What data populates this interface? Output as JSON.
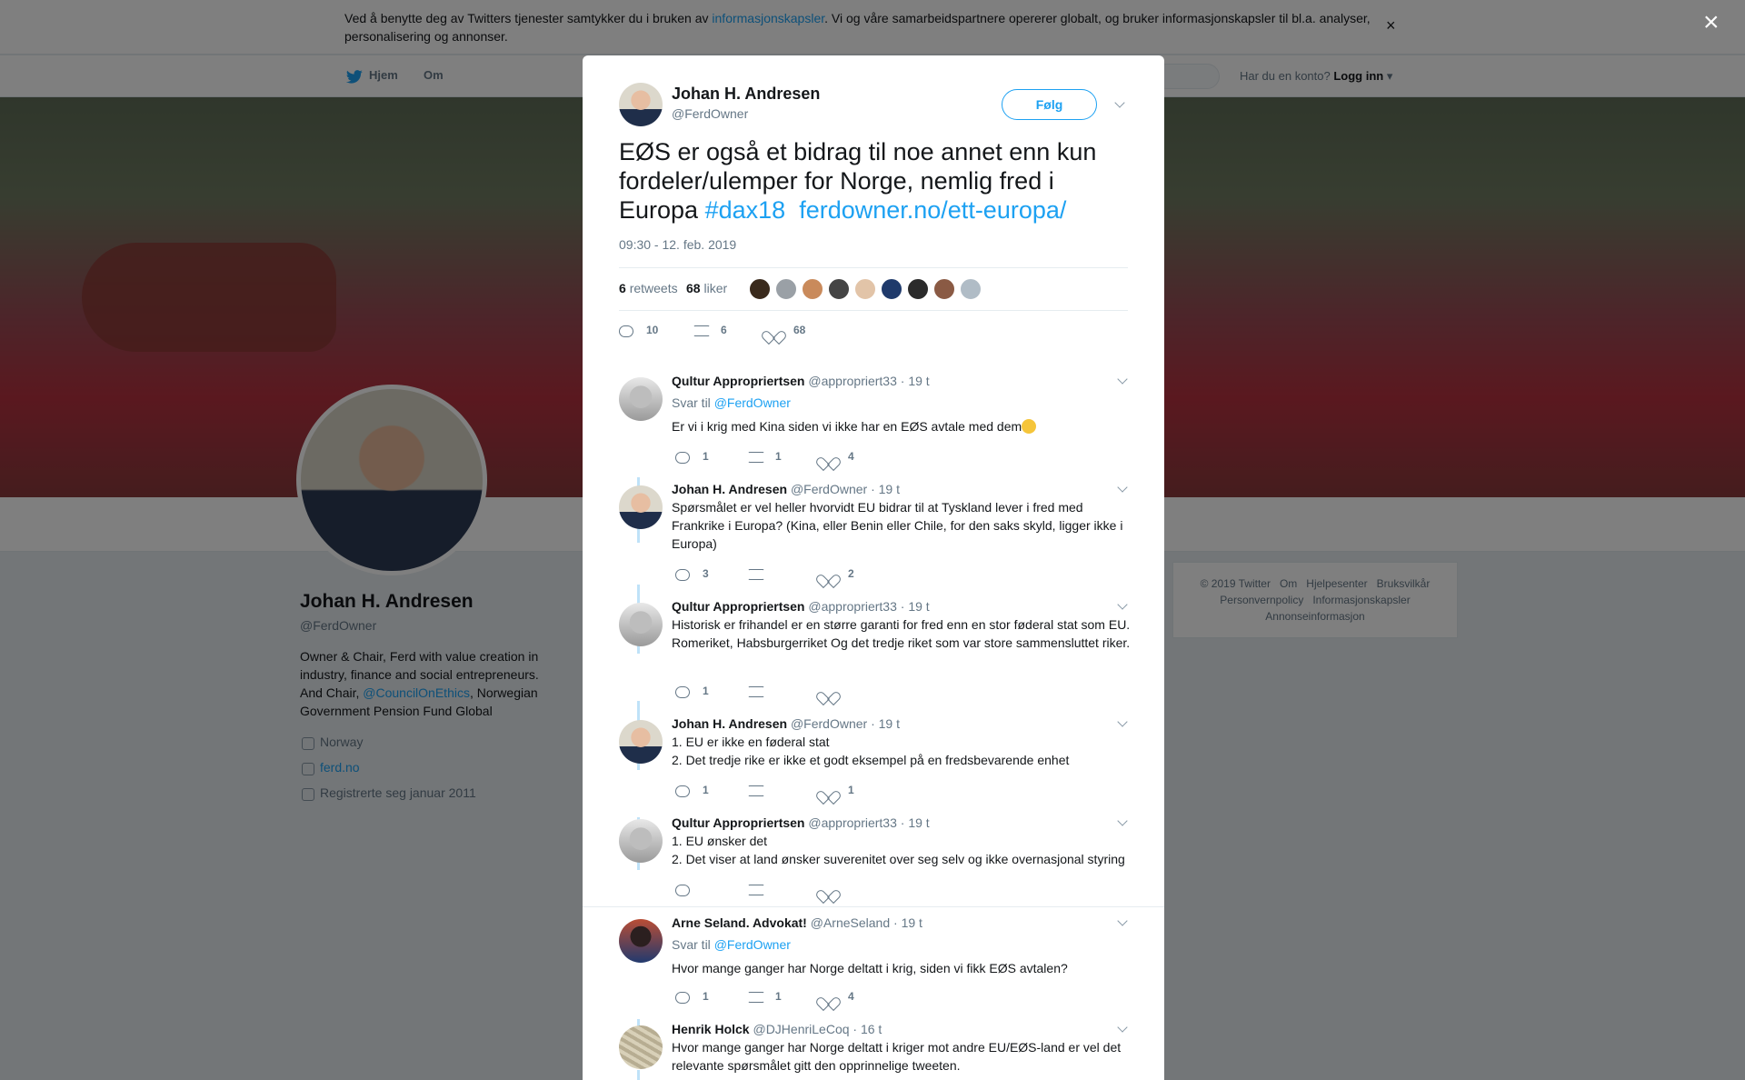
{
  "cookie_banner": {
    "text_before": "Ved å benytte deg av Twitters tjenester samtykker du i bruken av ",
    "link": "informasjonskapsler",
    "text_after": ". Vi og våre samarbeidspartnere opererer globalt, og bruker informasjonskapsler til bl.a. analyser, personalisering og annonser."
  },
  "nav": {
    "home_label": "Hjem",
    "about_label": "Om",
    "account_prompt": "Har du en konto?",
    "login_label": "Logg inn"
  },
  "profile": {
    "name": "Johan H. Andresen",
    "handle": "@FerdOwner",
    "bio_before": "Owner & Chair, Ferd with value creation in industry, finance and social entrepreneurs. And Chair, ",
    "bio_link": "@CouncilOnEthics",
    "bio_after": ", Norwegian Government Pension Fund Global",
    "location": "Norway",
    "website": "ferd.no",
    "joined": "Registrerte seg januar 2011"
  },
  "footer": {
    "row1": [
      "© 2019 Twitter",
      "Om",
      "Hjelpesenter",
      "Bruksvilkår"
    ],
    "row2": [
      "Personvernpolicy",
      "Informasjonskapsler"
    ],
    "row3": [
      "Annonseinformasjon"
    ]
  },
  "tweet": {
    "author_name": "Johan H. Andresen",
    "author_handle": "@FerdOwner",
    "follow_label": "Følg",
    "text": "EØS er også et bidrag til noe annet enn kun fordeler/ulemper for Norge, nemlig fred i Europa ",
    "hashtag": "#dax18",
    "link": "ferdowner.no/ett-europa/",
    "timestamp": "09:30 - 12. feb. 2019",
    "retweets_count": "6",
    "retweets_label": "retweets",
    "likes_count": "68",
    "likes_label": "liker",
    "reply_count": "10",
    "retweet_action_count": "6",
    "like_action_count": "68"
  },
  "replies": [
    {
      "name": "Qultur Appropriertsen",
      "handle": "@appropriert33",
      "time": "· 19 t",
      "reply_to_label": "Svar til",
      "reply_to": "@FerdOwner",
      "text": "Er vi i krig med Kina siden vi ikke har en EØS avtale med dem",
      "emoji": "thinking-face",
      "replies": "1",
      "retweets": "1",
      "likes": "4",
      "avatar": "qultur"
    },
    {
      "name": "Johan H. Andresen",
      "handle": "@FerdOwner",
      "time": "· 19 t",
      "text": "Spørsmålet er vel heller hvorvidt EU bidrar til at Tyskland lever i fred med Frankrike i Europa? (Kina, eller Benin eller Chile, for den saks skyld, ligger ikke i Europa)",
      "replies": "3",
      "retweets": "",
      "likes": "2",
      "avatar": "johan"
    },
    {
      "name": "Qultur Appropriertsen",
      "handle": "@appropriert33",
      "time": "· 19 t",
      "text": "Historisk er frihandel er en større garanti for fred enn en stor føderal stat som EU. Romeriket, Habsburgerriket Og det tredje riket som var store sammensluttet riker.",
      "replies": "1",
      "retweets": "",
      "likes": "",
      "avatar": "qultur"
    },
    {
      "name": "Johan H. Andresen",
      "handle": "@FerdOwner",
      "time": "· 19 t",
      "text_lines": [
        "1. EU er ikke en føderal stat",
        "2. Det tredje rike er ikke et godt eksempel på en fredsbevarende enhet"
      ],
      "replies": "1",
      "retweets": "",
      "likes": "1",
      "avatar": "johan"
    },
    {
      "name": "Qultur Appropriertsen",
      "handle": "@appropriert33",
      "time": "· 19 t",
      "text_lines": [
        "1. EU ønsker det",
        "2. Det viser at land ønsker suverenitet over seg selv og ikke overnasjonal styring"
      ],
      "replies": "",
      "retweets": "",
      "likes": "",
      "avatar": "qultur"
    },
    {
      "name": "Arne Seland. Advokat!",
      "handle": "@ArneSeland",
      "time": "· 19 t",
      "reply_to_label": "Svar til",
      "reply_to": "@FerdOwner",
      "text": "Hvor mange ganger har Norge deltatt i krig, siden vi fikk EØS avtalen?",
      "replies": "1",
      "retweets": "1",
      "likes": "4",
      "avatar": "arne"
    },
    {
      "name": "Henrik Holck",
      "handle": "@DJHenriLeCoq",
      "time": "· 16 t",
      "text": "Hvor mange ganger har Norge deltatt i kriger mot andre EU/EØS-land er vel det relevante spørsmålet gitt den opprinnelige tweeten.",
      "avatar": "henrik"
    }
  ],
  "colors": {
    "accent": "#1da1f2",
    "text": "#14171a",
    "muted": "#657786",
    "thread_line": "#bfe2f8"
  }
}
